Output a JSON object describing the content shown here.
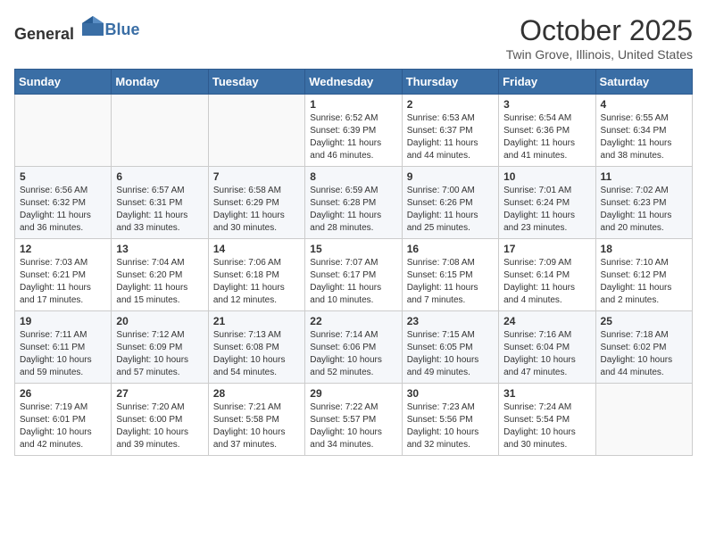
{
  "header": {
    "logo_general": "General",
    "logo_blue": "Blue",
    "month": "October 2025",
    "location": "Twin Grove, Illinois, United States"
  },
  "weekdays": [
    "Sunday",
    "Monday",
    "Tuesday",
    "Wednesday",
    "Thursday",
    "Friday",
    "Saturday"
  ],
  "weeks": [
    [
      {
        "day": "",
        "info": ""
      },
      {
        "day": "",
        "info": ""
      },
      {
        "day": "",
        "info": ""
      },
      {
        "day": "1",
        "info": "Sunrise: 6:52 AM\nSunset: 6:39 PM\nDaylight: 11 hours\nand 46 minutes."
      },
      {
        "day": "2",
        "info": "Sunrise: 6:53 AM\nSunset: 6:37 PM\nDaylight: 11 hours\nand 44 minutes."
      },
      {
        "day": "3",
        "info": "Sunrise: 6:54 AM\nSunset: 6:36 PM\nDaylight: 11 hours\nand 41 minutes."
      },
      {
        "day": "4",
        "info": "Sunrise: 6:55 AM\nSunset: 6:34 PM\nDaylight: 11 hours\nand 38 minutes."
      }
    ],
    [
      {
        "day": "5",
        "info": "Sunrise: 6:56 AM\nSunset: 6:32 PM\nDaylight: 11 hours\nand 36 minutes."
      },
      {
        "day": "6",
        "info": "Sunrise: 6:57 AM\nSunset: 6:31 PM\nDaylight: 11 hours\nand 33 minutes."
      },
      {
        "day": "7",
        "info": "Sunrise: 6:58 AM\nSunset: 6:29 PM\nDaylight: 11 hours\nand 30 minutes."
      },
      {
        "day": "8",
        "info": "Sunrise: 6:59 AM\nSunset: 6:28 PM\nDaylight: 11 hours\nand 28 minutes."
      },
      {
        "day": "9",
        "info": "Sunrise: 7:00 AM\nSunset: 6:26 PM\nDaylight: 11 hours\nand 25 minutes."
      },
      {
        "day": "10",
        "info": "Sunrise: 7:01 AM\nSunset: 6:24 PM\nDaylight: 11 hours\nand 23 minutes."
      },
      {
        "day": "11",
        "info": "Sunrise: 7:02 AM\nSunset: 6:23 PM\nDaylight: 11 hours\nand 20 minutes."
      }
    ],
    [
      {
        "day": "12",
        "info": "Sunrise: 7:03 AM\nSunset: 6:21 PM\nDaylight: 11 hours\nand 17 minutes."
      },
      {
        "day": "13",
        "info": "Sunrise: 7:04 AM\nSunset: 6:20 PM\nDaylight: 11 hours\nand 15 minutes."
      },
      {
        "day": "14",
        "info": "Sunrise: 7:06 AM\nSunset: 6:18 PM\nDaylight: 11 hours\nand 12 minutes."
      },
      {
        "day": "15",
        "info": "Sunrise: 7:07 AM\nSunset: 6:17 PM\nDaylight: 11 hours\nand 10 minutes."
      },
      {
        "day": "16",
        "info": "Sunrise: 7:08 AM\nSunset: 6:15 PM\nDaylight: 11 hours\nand 7 minutes."
      },
      {
        "day": "17",
        "info": "Sunrise: 7:09 AM\nSunset: 6:14 PM\nDaylight: 11 hours\nand 4 minutes."
      },
      {
        "day": "18",
        "info": "Sunrise: 7:10 AM\nSunset: 6:12 PM\nDaylight: 11 hours\nand 2 minutes."
      }
    ],
    [
      {
        "day": "19",
        "info": "Sunrise: 7:11 AM\nSunset: 6:11 PM\nDaylight: 10 hours\nand 59 minutes."
      },
      {
        "day": "20",
        "info": "Sunrise: 7:12 AM\nSunset: 6:09 PM\nDaylight: 10 hours\nand 57 minutes."
      },
      {
        "day": "21",
        "info": "Sunrise: 7:13 AM\nSunset: 6:08 PM\nDaylight: 10 hours\nand 54 minutes."
      },
      {
        "day": "22",
        "info": "Sunrise: 7:14 AM\nSunset: 6:06 PM\nDaylight: 10 hours\nand 52 minutes."
      },
      {
        "day": "23",
        "info": "Sunrise: 7:15 AM\nSunset: 6:05 PM\nDaylight: 10 hours\nand 49 minutes."
      },
      {
        "day": "24",
        "info": "Sunrise: 7:16 AM\nSunset: 6:04 PM\nDaylight: 10 hours\nand 47 minutes."
      },
      {
        "day": "25",
        "info": "Sunrise: 7:18 AM\nSunset: 6:02 PM\nDaylight: 10 hours\nand 44 minutes."
      }
    ],
    [
      {
        "day": "26",
        "info": "Sunrise: 7:19 AM\nSunset: 6:01 PM\nDaylight: 10 hours\nand 42 minutes."
      },
      {
        "day": "27",
        "info": "Sunrise: 7:20 AM\nSunset: 6:00 PM\nDaylight: 10 hours\nand 39 minutes."
      },
      {
        "day": "28",
        "info": "Sunrise: 7:21 AM\nSunset: 5:58 PM\nDaylight: 10 hours\nand 37 minutes."
      },
      {
        "day": "29",
        "info": "Sunrise: 7:22 AM\nSunset: 5:57 PM\nDaylight: 10 hours\nand 34 minutes."
      },
      {
        "day": "30",
        "info": "Sunrise: 7:23 AM\nSunset: 5:56 PM\nDaylight: 10 hours\nand 32 minutes."
      },
      {
        "day": "31",
        "info": "Sunrise: 7:24 AM\nSunset: 5:54 PM\nDaylight: 10 hours\nand 30 minutes."
      },
      {
        "day": "",
        "info": ""
      }
    ]
  ]
}
